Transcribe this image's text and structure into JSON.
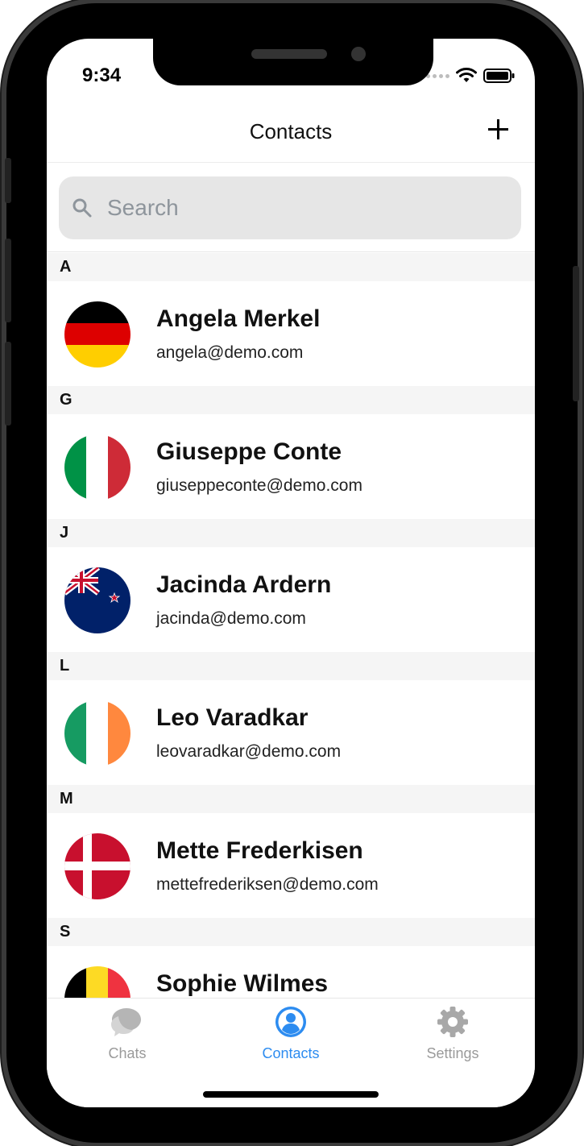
{
  "status_bar": {
    "time": "9:34"
  },
  "header": {
    "title": "Contacts",
    "add_icon": "plus-icon"
  },
  "search": {
    "placeholder": "Search",
    "value": "",
    "icon": "search-icon"
  },
  "sections": [
    {
      "letter": "A",
      "contacts": [
        {
          "name": "Angela Merkel",
          "email": "angela@demo.com",
          "avatar": "flag-germany"
        }
      ]
    },
    {
      "letter": "G",
      "contacts": [
        {
          "name": "Giuseppe Conte",
          "email": "giuseppeconte@demo.com",
          "avatar": "flag-italy"
        }
      ]
    },
    {
      "letter": "J",
      "contacts": [
        {
          "name": "Jacinda Ardern",
          "email": "jacinda@demo.com",
          "avatar": "flag-new-zealand"
        }
      ]
    },
    {
      "letter": "L",
      "contacts": [
        {
          "name": "Leo Varadkar",
          "email": "leovaradkar@demo.com",
          "avatar": "flag-ireland"
        }
      ]
    },
    {
      "letter": "M",
      "contacts": [
        {
          "name": "Mette Frederkisen",
          "email": "mettefrederiksen@demo.com",
          "avatar": "flag-denmark"
        }
      ]
    },
    {
      "letter": "S",
      "contacts": [
        {
          "name": "Sophie Wilmes",
          "email": "",
          "avatar": "flag-belgium"
        }
      ]
    }
  ],
  "tabbar": {
    "active_color": "#2d8cf0",
    "inactive_color": "#9a9a9a",
    "tabs": [
      {
        "label": "Chats",
        "icon": "chat-bubbles-icon",
        "active": false
      },
      {
        "label": "Contacts",
        "icon": "person-icon",
        "active": true
      },
      {
        "label": "Settings",
        "icon": "gear-icon",
        "active": false
      }
    ]
  }
}
